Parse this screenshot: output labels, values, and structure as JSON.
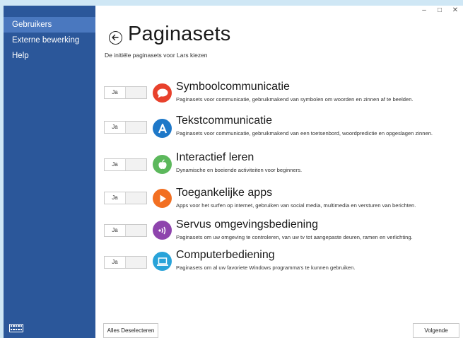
{
  "window": {
    "minimize": "–",
    "maximize": "□",
    "close": "✕"
  },
  "sidebar": {
    "items": [
      {
        "label": "Gebruikers",
        "active": true
      },
      {
        "label": "Externe bewerking",
        "active": false
      },
      {
        "label": "Help",
        "active": false
      }
    ],
    "keyboard_icon": "keyboard-icon"
  },
  "main": {
    "title": "Paginasets",
    "subtitle": "De initiële paginasets voor Lars kiezen",
    "back_icon": "back-arrow-icon"
  },
  "pagesets": [
    {
      "toggle_label": "Ja",
      "title": "Symboolcommunicatie",
      "description": "Paginasets voor communicatie, gebruikmakend van symbolen om woorden en zinnen af te beelden.",
      "icon": "speech-bubble-icon",
      "color": "#e8412c"
    },
    {
      "toggle_label": "Ja",
      "title": "Tekstcommunicatie",
      "description": "Paginasets voor communicatie, gebruikmakend van een toetsenbord, woordpredictie en opgeslagen zinnen.",
      "icon": "letter-a-icon",
      "color": "#1e78c8"
    },
    {
      "toggle_label": "Ja",
      "title": "Interactief leren",
      "description": "Dynamische en boeiende activiteiten voor beginners.",
      "icon": "apple-icon",
      "color": "#5cb85c"
    },
    {
      "toggle_label": "Ja",
      "title": "Toegankelijke apps",
      "description": "Apps voor het surfen op internet, gebruiken van social media, multimedia en versturen van berichten.",
      "icon": "play-icon",
      "color": "#f26f21"
    },
    {
      "toggle_label": "Ja",
      "title": "Servus omgevingsbediening",
      "description": "Paginasets om uw omgeving te controleren, van uw tv tot aangepaste deuren, ramen en verlichting.",
      "icon": "signal-icon",
      "color": "#8e44ad"
    },
    {
      "toggle_label": "Ja",
      "title": "Computerbediening",
      "description": "Paginasets om al uw favoriete Windows programma's te kunnen gebruiken.",
      "icon": "laptop-icon",
      "color": "#29a3d9"
    }
  ],
  "footer": {
    "deselect_label": "Alles Deselecteren",
    "next_label": "Volgende"
  }
}
